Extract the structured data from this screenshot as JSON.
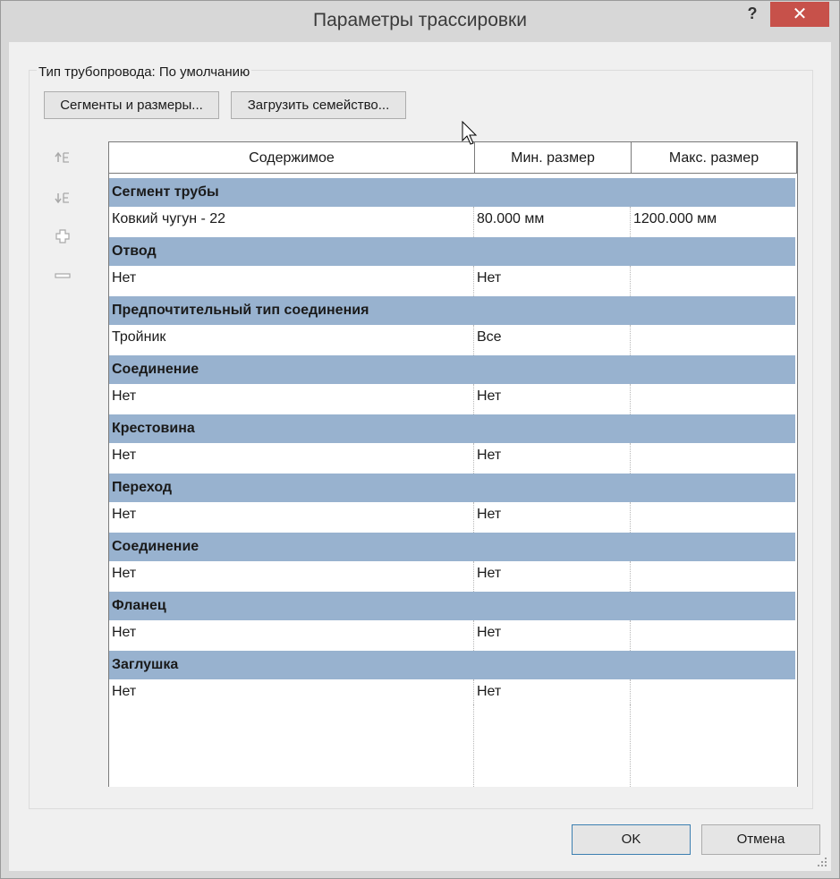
{
  "window": {
    "title": "Параметры трассировки"
  },
  "titlebar": {
    "help_label": "?",
    "close_label": "✕"
  },
  "pipe_type": {
    "label": "Тип трубопровода: По умолчанию"
  },
  "toolbar": {
    "segments_button": "Сегменты и размеры...",
    "load_family_button": "Загрузить семейство..."
  },
  "side_icons": [
    "move-up-icon",
    "move-down-icon",
    "add-row-icon",
    "remove-row-icon"
  ],
  "table": {
    "headers": [
      "Содержимое",
      "Мин. размер",
      "Макс. размер"
    ],
    "sections": [
      {
        "title": "Сегмент трубы",
        "row": [
          "Ковкий чугун - 22",
          "80.000 мм",
          "1200.000 мм"
        ]
      },
      {
        "title": "Отвод",
        "row": [
          "Нет",
          "Нет",
          ""
        ]
      },
      {
        "title": "Предпочтительный тип соединения",
        "row": [
          "Тройник",
          "Все",
          ""
        ]
      },
      {
        "title": "Соединение",
        "row": [
          "Нет",
          "Нет",
          ""
        ]
      },
      {
        "title": "Крестовина",
        "row": [
          "Нет",
          "Нет",
          ""
        ]
      },
      {
        "title": "Переход",
        "row": [
          "Нет",
          "Нет",
          ""
        ]
      },
      {
        "title": "Соединение",
        "row": [
          "Нет",
          "Нет",
          ""
        ]
      },
      {
        "title": "Фланец",
        "row": [
          "Нет",
          "Нет",
          ""
        ]
      },
      {
        "title": "Заглушка",
        "row": [
          "Нет",
          "Нет",
          ""
        ]
      }
    ]
  },
  "footer": {
    "ok_label": "OK",
    "cancel_label": "Отмена"
  },
  "colors": {
    "category_row": "#98b2cf",
    "close_button": "#c7514a",
    "ok_border": "#3c7fb1"
  }
}
